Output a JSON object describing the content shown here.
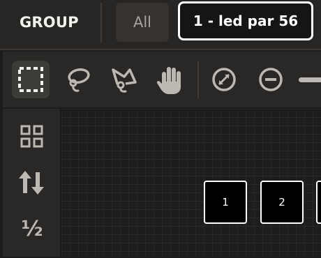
{
  "header": {
    "group_label": "GROUP",
    "all_button": "All",
    "selected_fixture": "1 - led par 56"
  },
  "toolbar": {
    "tools": [
      {
        "name": "rect-select-icon",
        "active": true
      },
      {
        "name": "lasso-icon",
        "active": false
      },
      {
        "name": "polygon-lasso-icon",
        "active": false
      },
      {
        "name": "hand-icon",
        "active": false
      },
      {
        "name": "zoom-fit-icon",
        "active": false
      },
      {
        "name": "zoom-out-icon",
        "active": false
      }
    ]
  },
  "sidebar": {
    "tools": [
      {
        "name": "grid-layout-icon"
      },
      {
        "name": "sort-icon"
      },
      {
        "name": "half-icon",
        "label": "½"
      }
    ]
  },
  "fixtures": [
    {
      "label": "1"
    },
    {
      "label": "2"
    },
    {
      "label": ""
    }
  ],
  "colors": {
    "background": "#282624",
    "panel": "#2a2826",
    "grid": "#1e1d1b",
    "accent": "#ffffff"
  }
}
